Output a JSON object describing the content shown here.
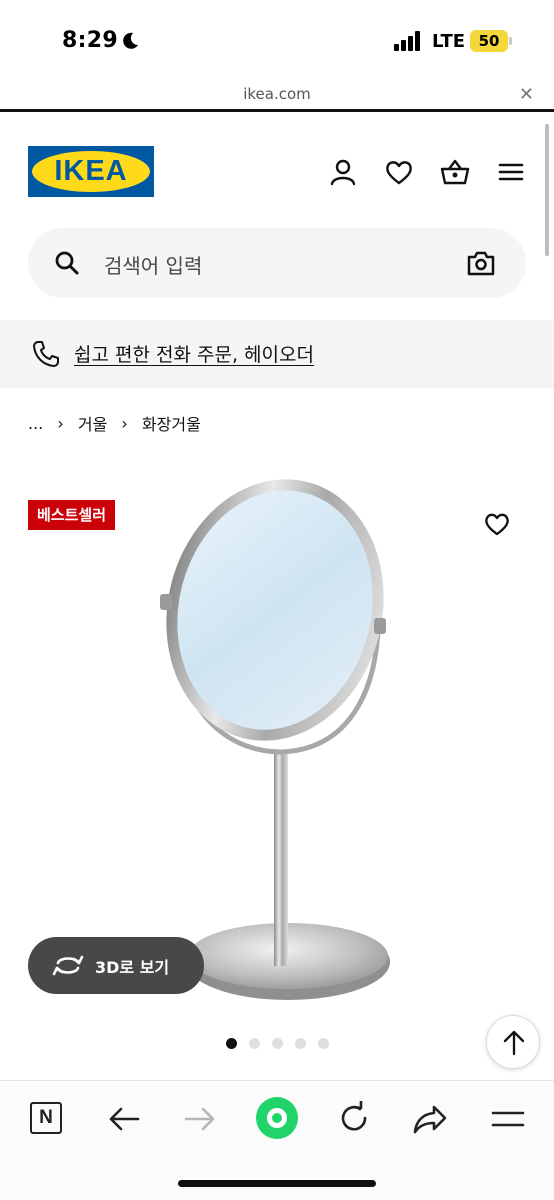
{
  "status_bar": {
    "time": "8:29",
    "network": "LTE",
    "battery": "50",
    "icons": [
      "moon-icon",
      "signal-icon"
    ]
  },
  "browser": {
    "url": "ikea.com",
    "close_icon": "close-icon"
  },
  "header": {
    "logo_text": "IKEA",
    "icons": [
      "user-icon",
      "heart-icon",
      "basket-icon",
      "menu-icon"
    ],
    "brand_colors": {
      "blue": "#0058a3",
      "yellow": "#ffda1a"
    }
  },
  "search": {
    "placeholder": "검색어 입력",
    "icons": [
      "search-icon",
      "camera-icon"
    ]
  },
  "promo": {
    "text": "쉽고 편한 전화 주문, 헤이오더",
    "icon": "phone-icon"
  },
  "breadcrumb": {
    "items": [
      "...",
      "거울",
      "화장거울"
    ]
  },
  "product": {
    "badge": "베스트셀러",
    "badge_color": "#cc0008",
    "image": "stainless-steel-makeup-mirror",
    "view_3d_label": "3D로 보기",
    "carousel": {
      "count": 5,
      "active_index": 0
    }
  },
  "bottom_bar": {
    "icons": [
      "n-tab-icon",
      "back-arrow-icon",
      "forward-arrow-icon",
      "green-home-icon",
      "reload-icon",
      "share-icon",
      "menu-lines-icon"
    ]
  }
}
